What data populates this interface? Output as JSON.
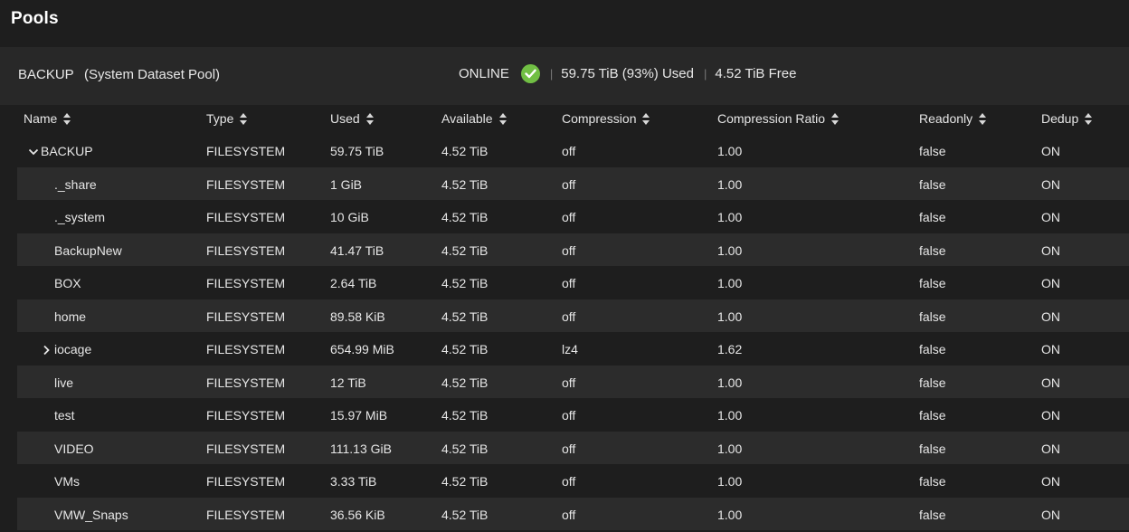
{
  "page": {
    "title": "Pools"
  },
  "pool": {
    "name": "BACKUP",
    "subtitle": "(System Dataset Pool)",
    "status": "ONLINE",
    "used": "59.75 TiB (93%) Used",
    "free": "4.52 TiB Free",
    "status_color": "#71bf44"
  },
  "table": {
    "columns": [
      "Name",
      "Type",
      "Used",
      "Available",
      "Compression",
      "Compression Ratio",
      "Readonly",
      "Dedup"
    ],
    "rows": [
      {
        "name": "BACKUP",
        "type": "FILESYSTEM",
        "used": "59.75 TiB",
        "available": "4.52 TiB",
        "compression": "off",
        "ratio": "1.00",
        "readonly": "false",
        "dedup": "ON",
        "expander": "chevron-down-icon"
      },
      {
        "name": "._share",
        "type": "FILESYSTEM",
        "used": "1 GiB",
        "available": "4.52 TiB",
        "compression": "off",
        "ratio": "1.00",
        "readonly": "false",
        "dedup": "ON"
      },
      {
        "name": "._system",
        "type": "FILESYSTEM",
        "used": "10 GiB",
        "available": "4.52 TiB",
        "compression": "off",
        "ratio": "1.00",
        "readonly": "false",
        "dedup": "ON"
      },
      {
        "name": "BackupNew",
        "type": "FILESYSTEM",
        "used": "41.47 TiB",
        "available": "4.52 TiB",
        "compression": "off",
        "ratio": "1.00",
        "readonly": "false",
        "dedup": "ON"
      },
      {
        "name": "BOX",
        "type": "FILESYSTEM",
        "used": "2.64 TiB",
        "available": "4.52 TiB",
        "compression": "off",
        "ratio": "1.00",
        "readonly": "false",
        "dedup": "ON"
      },
      {
        "name": "home",
        "type": "FILESYSTEM",
        "used": "89.58 KiB",
        "available": "4.52 TiB",
        "compression": "off",
        "ratio": "1.00",
        "readonly": "false",
        "dedup": "ON"
      },
      {
        "name": "iocage",
        "type": "FILESYSTEM",
        "used": "654.99 MiB",
        "available": "4.52 TiB",
        "compression": "lz4",
        "ratio": "1.62",
        "readonly": "false",
        "dedup": "ON",
        "expander": "chevron-right-icon"
      },
      {
        "name": "live",
        "type": "FILESYSTEM",
        "used": "12 TiB",
        "available": "4.52 TiB",
        "compression": "off",
        "ratio": "1.00",
        "readonly": "false",
        "dedup": "ON"
      },
      {
        "name": "test",
        "type": "FILESYSTEM",
        "used": "15.97 MiB",
        "available": "4.52 TiB",
        "compression": "off",
        "ratio": "1.00",
        "readonly": "false",
        "dedup": "ON"
      },
      {
        "name": "VIDEO",
        "type": "FILESYSTEM",
        "used": "111.13 GiB",
        "available": "4.52 TiB",
        "compression": "off",
        "ratio": "1.00",
        "readonly": "false",
        "dedup": "ON"
      },
      {
        "name": "VMs",
        "type": "FILESYSTEM",
        "used": "3.33 TiB",
        "available": "4.52 TiB",
        "compression": "off",
        "ratio": "1.00",
        "readonly": "false",
        "dedup": "ON"
      },
      {
        "name": "VMW_Snaps",
        "type": "FILESYSTEM",
        "used": "36.56 KiB",
        "available": "4.52 TiB",
        "compression": "off",
        "ratio": "1.00",
        "readonly": "false",
        "dedup": "ON"
      }
    ]
  }
}
